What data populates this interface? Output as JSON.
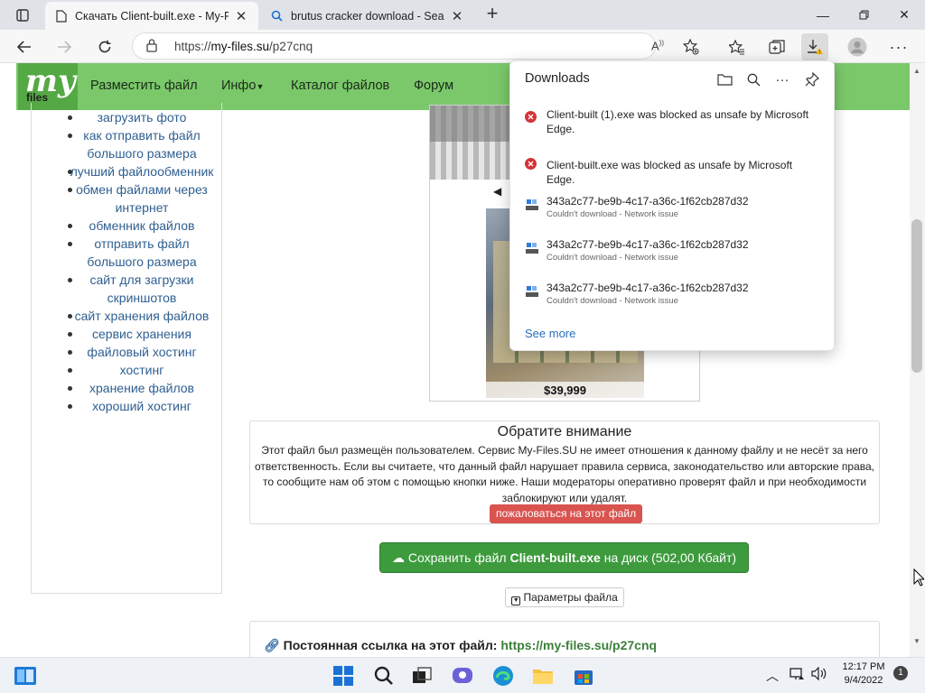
{
  "browser": {
    "tabs": [
      {
        "title": "Скачать Client-built.exe - My-Fil",
        "active": true
      },
      {
        "title": "brutus cracker download - Searc",
        "active": false
      }
    ],
    "address": {
      "prefix": "https://",
      "host": "my-files.su",
      "path": "/p27cnq"
    }
  },
  "site": {
    "logo": {
      "my": "my",
      "files": "files"
    },
    "nav": [
      "Разместить файл",
      "Инфо",
      "Каталог файлов",
      "Форум"
    ]
  },
  "sidebar": {
    "links": [
      "загрузить фото",
      "как отправить файл большого размера",
      "лучший файлообменник",
      "обмен файлами через интернет",
      "обменник файлов",
      "отправить файл большого размера",
      "сайт для загрузки скриншотов",
      "сайт хранения файлов",
      "сервис хранения",
      "файловый хостинг",
      "хостинг",
      "хранение файлов",
      "хороший хостинг"
    ]
  },
  "preview": {
    "price": "$39,999"
  },
  "notice": {
    "title": "Обратите внимание",
    "text": "Этот файл был размещён пользователем. Сервис My-Files.SU не имеет отношения к данному файлу и не несёт за него ответственность. Если вы считаете, что данный файл нарушает правила сервиса, законодательство или авторские права, то сообщите нам об этом с помощью кнопки ниже. Наши модераторы оперативно проверят файл и при необходимости заблокируют или удалят.",
    "report_label": "пожаловаться на этот файл"
  },
  "save": {
    "prefix": "Сохранить файл ",
    "filename": "Client-built.exe",
    "suffix": " на диск (502,00 Кбайт)"
  },
  "params_label": "Параметры файла",
  "permalink": {
    "label": "Постоянная ссылка на этот файл: ",
    "url": "https://my-files.su/p27cnq"
  },
  "downloads": {
    "title": "Downloads",
    "items": [
      {
        "name": "Client-built (1).exe was blocked as unsafe by Microsoft Edge.",
        "status": "",
        "type": "blocked"
      },
      {
        "name": "Client-built.exe was blocked as unsafe by Microsoft Edge.",
        "status": "",
        "type": "blocked"
      },
      {
        "name": "343a2c77-be9b-4c17-a36c-1f62cb287d32",
        "status": "Couldn't download - Network issue",
        "type": "failed"
      },
      {
        "name": "343a2c77-be9b-4c17-a36c-1f62cb287d32",
        "status": "Couldn't download - Network issue",
        "type": "failed"
      },
      {
        "name": "343a2c77-be9b-4c17-a36c-1f62cb287d32",
        "status": "Couldn't download - Network issue",
        "type": "failed"
      }
    ],
    "see_more": "See more"
  },
  "taskbar": {
    "time": "12:17 PM",
    "date": "9/4/2022",
    "notifications": "1"
  },
  "colors": {
    "nav_green": "#7bc86a",
    "save_green": "#3d9b3d",
    "report_red": "#d9534f",
    "link_blue": "#2f5f91",
    "error_red": "#d13438"
  }
}
